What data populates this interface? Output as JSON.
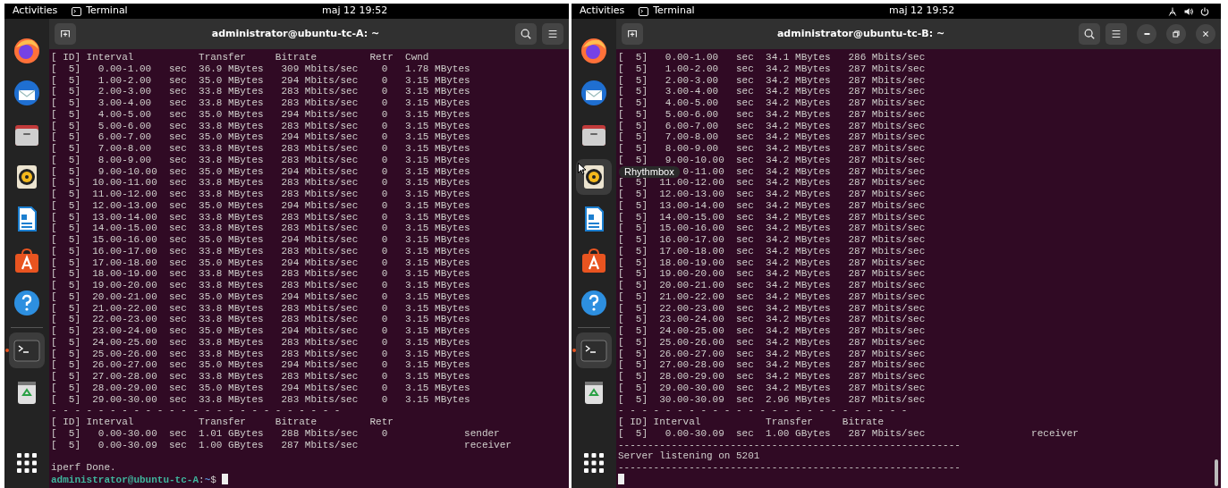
{
  "screens": [
    {
      "top_bar": {
        "activities": "Activities",
        "app": "Terminal",
        "clock": "maj 12  19:52"
      },
      "dock": {
        "items": [
          {
            "kind": "firefox",
            "highlighted": false,
            "running": false
          },
          {
            "kind": "thunderbird",
            "highlighted": false,
            "running": false
          },
          {
            "kind": "files",
            "highlighted": false,
            "running": false
          },
          {
            "kind": "rhythmbox",
            "highlighted": false,
            "running": false
          },
          {
            "kind": "writer",
            "highlighted": false,
            "running": false
          },
          {
            "kind": "appcenter",
            "highlighted": false,
            "running": false
          },
          {
            "kind": "help",
            "highlighted": false,
            "running": false
          },
          {
            "kind": "separator"
          },
          {
            "kind": "terminal",
            "highlighted": true,
            "running": true
          },
          {
            "kind": "trash",
            "highlighted": false,
            "running": false
          },
          {
            "kind": "apps-grid",
            "highlighted": false,
            "running": false
          }
        ]
      },
      "terminal": {
        "title": "administrator@ubuntu-tc-A: ~",
        "left_buttons": [
          {
            "kind": "new-tab"
          }
        ],
        "buttons": [
          {
            "kind": "search"
          },
          {
            "kind": "menu"
          }
        ],
        "lines": [
          {
            "kind": "text",
            "text": "[ ID] Interval           Transfer     Bitrate         Retr  Cwnd"
          },
          {
            "kind": "text",
            "text": "[  5]   0.00-1.00   sec  36.9 MBytes   309 Mbits/sec    0   1.78 MBytes"
          },
          {
            "kind": "text",
            "text": "[  5]   1.00-2.00   sec  35.0 MBytes   294 Mbits/sec    0   3.15 MBytes"
          },
          {
            "kind": "text",
            "text": "[  5]   2.00-3.00   sec  33.8 MBytes   283 Mbits/sec    0   3.15 MBytes"
          },
          {
            "kind": "text",
            "text": "[  5]   3.00-4.00   sec  33.8 MBytes   283 Mbits/sec    0   3.15 MBytes"
          },
          {
            "kind": "text",
            "text": "[  5]   4.00-5.00   sec  35.0 MBytes   294 Mbits/sec    0   3.15 MBytes"
          },
          {
            "kind": "text",
            "text": "[  5]   5.00-6.00   sec  33.8 MBytes   283 Mbits/sec    0   3.15 MBytes"
          },
          {
            "kind": "text",
            "text": "[  5]   6.00-7.00   sec  35.0 MBytes   294 Mbits/sec    0   3.15 MBytes"
          },
          {
            "kind": "text",
            "text": "[  5]   7.00-8.00   sec  33.8 MBytes   283 Mbits/sec    0   3.15 MBytes"
          },
          {
            "kind": "text",
            "text": "[  5]   8.00-9.00   sec  33.8 MBytes   283 Mbits/sec    0   3.15 MBytes"
          },
          {
            "kind": "text",
            "text": "[  5]   9.00-10.00  sec  35.0 MBytes   294 Mbits/sec    0   3.15 MBytes"
          },
          {
            "kind": "text",
            "text": "[  5]  10.00-11.00  sec  33.8 MBytes   283 Mbits/sec    0   3.15 MBytes"
          },
          {
            "kind": "text",
            "text": "[  5]  11.00-12.00  sec  33.8 MBytes   283 Mbits/sec    0   3.15 MBytes"
          },
          {
            "kind": "text",
            "text": "[  5]  12.00-13.00  sec  35.0 MBytes   294 Mbits/sec    0   3.15 MBytes"
          },
          {
            "kind": "text",
            "text": "[  5]  13.00-14.00  sec  33.8 MBytes   283 Mbits/sec    0   3.15 MBytes"
          },
          {
            "kind": "text",
            "text": "[  5]  14.00-15.00  sec  33.8 MBytes   283 Mbits/sec    0   3.15 MBytes"
          },
          {
            "kind": "text",
            "text": "[  5]  15.00-16.00  sec  35.0 MBytes   294 Mbits/sec    0   3.15 MBytes"
          },
          {
            "kind": "text",
            "text": "[  5]  16.00-17.00  sec  33.8 MBytes   283 Mbits/sec    0   3.15 MBytes"
          },
          {
            "kind": "text",
            "text": "[  5]  17.00-18.00  sec  35.0 MBytes   294 Mbits/sec    0   3.15 MBytes"
          },
          {
            "kind": "text",
            "text": "[  5]  18.00-19.00  sec  33.8 MBytes   283 Mbits/sec    0   3.15 MBytes"
          },
          {
            "kind": "text",
            "text": "[  5]  19.00-20.00  sec  33.8 MBytes   283 Mbits/sec    0   3.15 MBytes"
          },
          {
            "kind": "text",
            "text": "[  5]  20.00-21.00  sec  35.0 MBytes   294 Mbits/sec    0   3.15 MBytes"
          },
          {
            "kind": "text",
            "text": "[  5]  21.00-22.00  sec  33.8 MBytes   283 Mbits/sec    0   3.15 MBytes"
          },
          {
            "kind": "text",
            "text": "[  5]  22.00-23.00  sec  33.8 MBytes   283 Mbits/sec    0   3.15 MBytes"
          },
          {
            "kind": "text",
            "text": "[  5]  23.00-24.00  sec  35.0 MBytes   294 Mbits/sec    0   3.15 MBytes"
          },
          {
            "kind": "text",
            "text": "[  5]  24.00-25.00  sec  33.8 MBytes   283 Mbits/sec    0   3.15 MBytes"
          },
          {
            "kind": "text",
            "text": "[  5]  25.00-26.00  sec  33.8 MBytes   283 Mbits/sec    0   3.15 MBytes"
          },
          {
            "kind": "text",
            "text": "[  5]  26.00-27.00  sec  35.0 MBytes   294 Mbits/sec    0   3.15 MBytes"
          },
          {
            "kind": "text",
            "text": "[  5]  27.00-28.00  sec  33.8 MBytes   283 Mbits/sec    0   3.15 MBytes"
          },
          {
            "kind": "text",
            "text": "[  5]  28.00-29.00  sec  35.0 MBytes   294 Mbits/sec    0   3.15 MBytes"
          },
          {
            "kind": "text",
            "text": "[  5]  29.00-30.00  sec  33.8 MBytes   283 Mbits/sec    0   3.15 MBytes"
          },
          {
            "kind": "text",
            "text": "- - - - - - - - - - - - - - - - - - - - - - - - -"
          },
          {
            "kind": "text",
            "text": "[ ID] Interval           Transfer     Bitrate         Retr"
          },
          {
            "kind": "text",
            "text": "[  5]   0.00-30.00  sec  1.01 GBytes   288 Mbits/sec    0             sender"
          },
          {
            "kind": "text",
            "text": "[  5]   0.00-30.09  sec  1.00 GBytes   287 Mbits/sec                  receiver"
          },
          {
            "kind": "blank"
          },
          {
            "kind": "text",
            "text": "iperf Done."
          },
          {
            "kind": "prompt",
            "user_host": "administrator@ubuntu-tc-A",
            "sep": ":",
            "path": "~",
            "symbol": "$",
            "cursor": true
          }
        ]
      }
    },
    {
      "top_bar": {
        "activities": "Activities",
        "app": "Terminal",
        "clock": "maj 12  19:52",
        "tray": [
          {
            "kind": "network"
          },
          {
            "kind": "volume"
          },
          {
            "kind": "power"
          }
        ]
      },
      "dock": {
        "items": [
          {
            "kind": "firefox",
            "highlighted": false,
            "running": false
          },
          {
            "kind": "thunderbird",
            "highlighted": false,
            "running": false
          },
          {
            "kind": "files",
            "highlighted": false,
            "running": false
          },
          {
            "kind": "rhythmbox",
            "highlighted": true,
            "running": false
          },
          {
            "kind": "writer",
            "highlighted": false,
            "running": false
          },
          {
            "kind": "appcenter",
            "highlighted": false,
            "running": false
          },
          {
            "kind": "help",
            "highlighted": false,
            "running": false
          },
          {
            "kind": "separator"
          },
          {
            "kind": "terminal",
            "highlighted": true,
            "running": true
          },
          {
            "kind": "trash",
            "highlighted": false,
            "running": false
          },
          {
            "kind": "apps-grid",
            "highlighted": false,
            "running": false
          }
        ]
      },
      "terminal": {
        "title": "administrator@ubuntu-tc-B: ~",
        "left_buttons": [
          {
            "kind": "new-tab"
          }
        ],
        "buttons": [
          {
            "kind": "search"
          },
          {
            "kind": "menu"
          }
        ],
        "window_controls": [
          {
            "kind": "minimize"
          },
          {
            "kind": "maximize"
          },
          {
            "kind": "close"
          }
        ],
        "scrollbar": true,
        "lines": [
          {
            "kind": "text",
            "text": "[  5]   0.00-1.00   sec  34.1 MBytes   286 Mbits/sec"
          },
          {
            "kind": "text",
            "text": "[  5]   1.00-2.00   sec  34.2 MBytes   287 Mbits/sec"
          },
          {
            "kind": "text",
            "text": "[  5]   2.00-3.00   sec  34.2 MBytes   287 Mbits/sec"
          },
          {
            "kind": "text",
            "text": "[  5]   3.00-4.00   sec  34.2 MBytes   287 Mbits/sec"
          },
          {
            "kind": "text",
            "text": "[  5]   4.00-5.00   sec  34.2 MBytes   287 Mbits/sec"
          },
          {
            "kind": "text",
            "text": "[  5]   5.00-6.00   sec  34.2 MBytes   287 Mbits/sec"
          },
          {
            "kind": "text",
            "text": "[  5]   6.00-7.00   sec  34.2 MBytes   287 Mbits/sec"
          },
          {
            "kind": "text",
            "text": "[  5]   7.00-8.00   sec  34.2 MBytes   287 Mbits/sec"
          },
          {
            "kind": "text",
            "text": "[  5]   8.00-9.00   sec  34.2 MBytes   287 Mbits/sec"
          },
          {
            "kind": "text",
            "text": "[  5]   9.00-10.00  sec  34.2 MBytes   287 Mbits/sec"
          },
          {
            "kind": "text",
            "text": "0-11.00  sec  34.2 MBytes   287 Mbits/sec",
            "covered": true
          },
          {
            "kind": "text",
            "text": "[  5]  11.00-12.00  sec  34.2 MBytes   287 Mbits/sec"
          },
          {
            "kind": "text",
            "text": "[  5]  12.00-13.00  sec  34.2 MBytes   287 Mbits/sec"
          },
          {
            "kind": "text",
            "text": "[  5]  13.00-14.00  sec  34.2 MBytes   287 Mbits/sec"
          },
          {
            "kind": "text",
            "text": "[  5]  14.00-15.00  sec  34.2 MBytes   287 Mbits/sec"
          },
          {
            "kind": "text",
            "text": "[  5]  15.00-16.00  sec  34.2 MBytes   287 Mbits/sec"
          },
          {
            "kind": "text",
            "text": "[  5]  16.00-17.00  sec  34.2 MBytes   287 Mbits/sec"
          },
          {
            "kind": "text",
            "text": "[  5]  17.00-18.00  sec  34.2 MBytes   287 Mbits/sec"
          },
          {
            "kind": "text",
            "text": "[  5]  18.00-19.00  sec  34.2 MBytes   287 Mbits/sec"
          },
          {
            "kind": "text",
            "text": "[  5]  19.00-20.00  sec  34.2 MBytes   287 Mbits/sec"
          },
          {
            "kind": "text",
            "text": "[  5]  20.00-21.00  sec  34.2 MBytes   287 Mbits/sec"
          },
          {
            "kind": "text",
            "text": "[  5]  21.00-22.00  sec  34.2 MBytes   287 Mbits/sec"
          },
          {
            "kind": "text",
            "text": "[  5]  22.00-23.00  sec  34.2 MBytes   287 Mbits/sec"
          },
          {
            "kind": "text",
            "text": "[  5]  23.00-24.00  sec  34.2 MBytes   287 Mbits/sec"
          },
          {
            "kind": "text",
            "text": "[  5]  24.00-25.00  sec  34.2 MBytes   287 Mbits/sec"
          },
          {
            "kind": "text",
            "text": "[  5]  25.00-26.00  sec  34.2 MBytes   287 Mbits/sec"
          },
          {
            "kind": "text",
            "text": "[  5]  26.00-27.00  sec  34.2 MBytes   287 Mbits/sec"
          },
          {
            "kind": "text",
            "text": "[  5]  27.00-28.00  sec  34.2 MBytes   287 Mbits/sec"
          },
          {
            "kind": "text",
            "text": "[  5]  28.00-29.00  sec  34.2 MBytes   287 Mbits/sec"
          },
          {
            "kind": "text",
            "text": "[  5]  29.00-30.00  sec  34.2 MBytes   287 Mbits/sec"
          },
          {
            "kind": "text",
            "text": "[  5]  30.00-30.09  sec  2.96 MBytes   287 Mbits/sec"
          },
          {
            "kind": "text",
            "text": "- - - - - - - - - - - - - - - - - - - - - - - - -"
          },
          {
            "kind": "text",
            "text": "[ ID] Interval           Transfer     Bitrate"
          },
          {
            "kind": "text",
            "text": "[  5]   0.00-30.09  sec  1.00 GBytes   287 Mbits/sec                  receiver"
          },
          {
            "kind": "text",
            "text": "----------------------------------------------------------"
          },
          {
            "kind": "text",
            "text": "Server listening on 5201"
          },
          {
            "kind": "text",
            "text": "----------------------------------------------------------"
          },
          {
            "kind": "cursor"
          }
        ]
      },
      "tooltip": {
        "text": "Rhythmbox"
      }
    }
  ]
}
